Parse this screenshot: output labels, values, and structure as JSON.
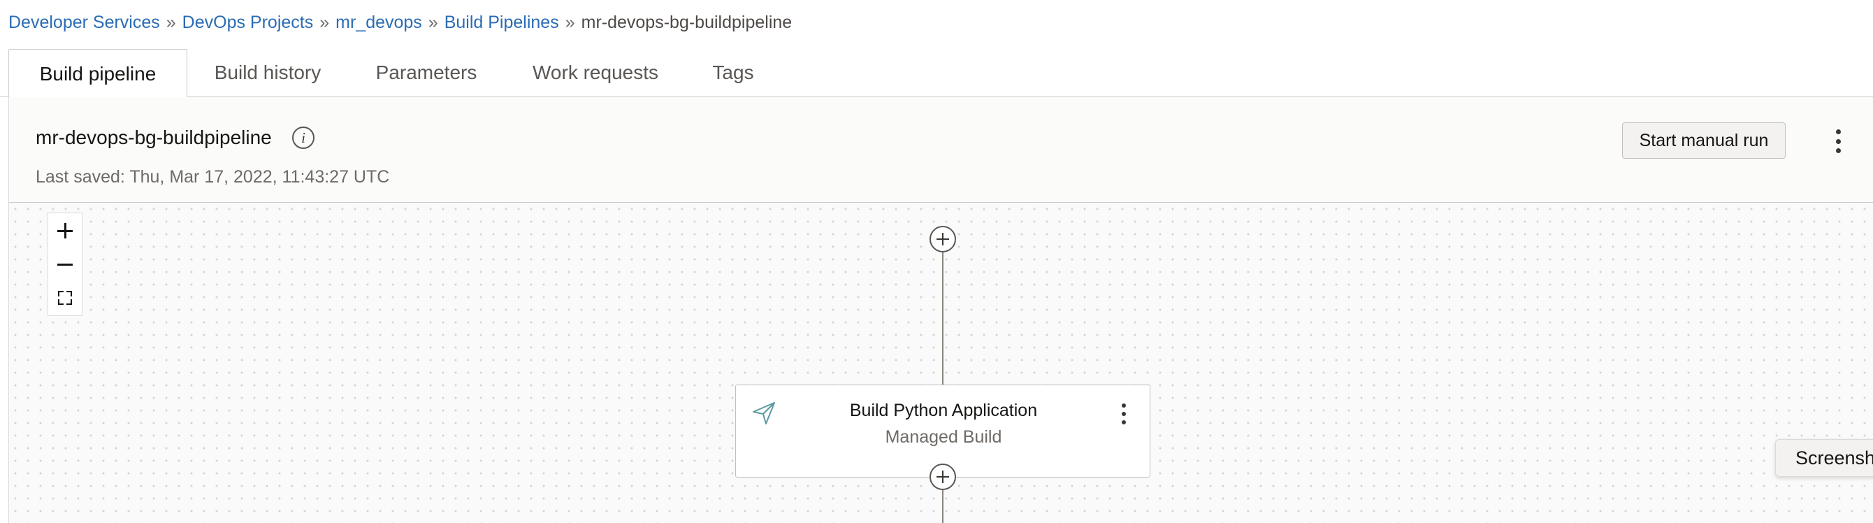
{
  "breadcrumb": {
    "items": [
      "Developer Services",
      "DevOps Projects",
      "mr_devops",
      "Build Pipelines"
    ],
    "separator": "»",
    "current": "mr-devops-bg-buildpipeline"
  },
  "tabs": [
    "Build pipeline",
    "Build history",
    "Parameters",
    "Work requests",
    "Tags"
  ],
  "header": {
    "pipeline_name": "mr-devops-bg-buildpipeline",
    "info_symbol": "i",
    "last_saved": "Last saved: Thu, Mar 17, 2022, 11:43:27 UTC",
    "start_button": "Start manual run"
  },
  "canvas": {
    "zoom_controls": [
      "zoom-in",
      "zoom-out",
      "fit-to-screen"
    ],
    "stage": {
      "title": "Build Python Application",
      "subtitle": "Managed Build",
      "icon": "paper-plane-icon"
    }
  },
  "floating_button": "Screensh",
  "colors": {
    "link": "#2b6cb4",
    "text": "#161513",
    "muted": "#6f6a66",
    "stage_icon": "#5a9aa0",
    "canvas_dot": "#d6d3d0"
  }
}
